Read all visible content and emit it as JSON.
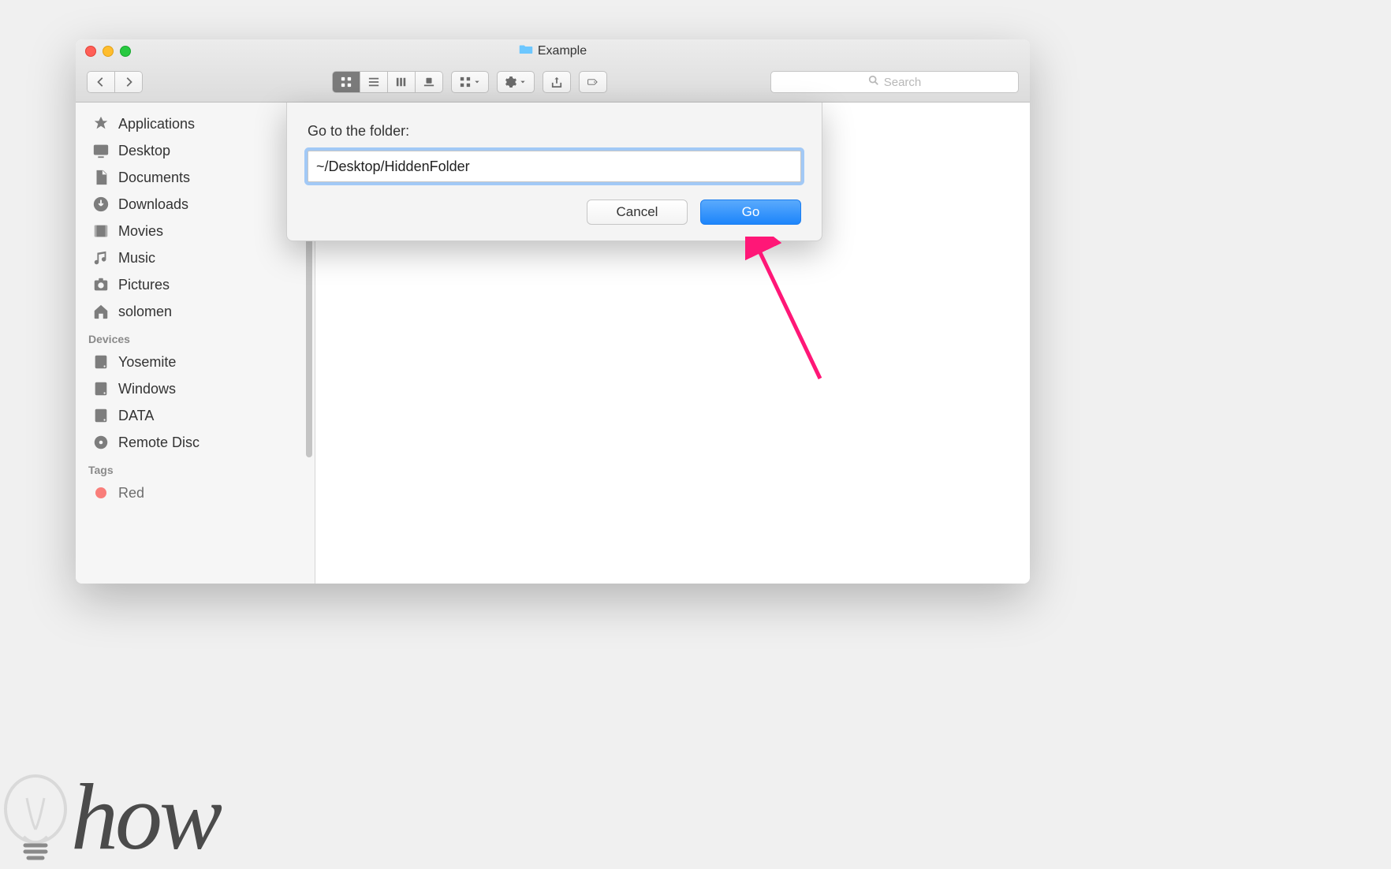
{
  "window": {
    "title": "Example"
  },
  "toolbar": {
    "search_placeholder": "Search"
  },
  "sidebar": {
    "favorites": [
      {
        "label": "Applications",
        "icon": "applications"
      },
      {
        "label": "Desktop",
        "icon": "desktop"
      },
      {
        "label": "Documents",
        "icon": "documents"
      },
      {
        "label": "Downloads",
        "icon": "downloads"
      },
      {
        "label": "Movies",
        "icon": "movies"
      },
      {
        "label": "Music",
        "icon": "music"
      },
      {
        "label": "Pictures",
        "icon": "pictures"
      },
      {
        "label": "solomen",
        "icon": "home"
      }
    ],
    "devices_label": "Devices",
    "devices": [
      {
        "label": "Yosemite",
        "icon": "hdd"
      },
      {
        "label": "Windows",
        "icon": "hdd"
      },
      {
        "label": "DATA",
        "icon": "hdd"
      },
      {
        "label": "Remote Disc",
        "icon": "disc"
      }
    ],
    "tags_label": "Tags",
    "tags": [
      {
        "label": "Red",
        "color": "#fb4b46"
      }
    ]
  },
  "dialog": {
    "label": "Go to the folder:",
    "path_value": "~/Desktop/HiddenFolder",
    "cancel_label": "Cancel",
    "go_label": "Go"
  },
  "watermark": {
    "text": "how"
  }
}
